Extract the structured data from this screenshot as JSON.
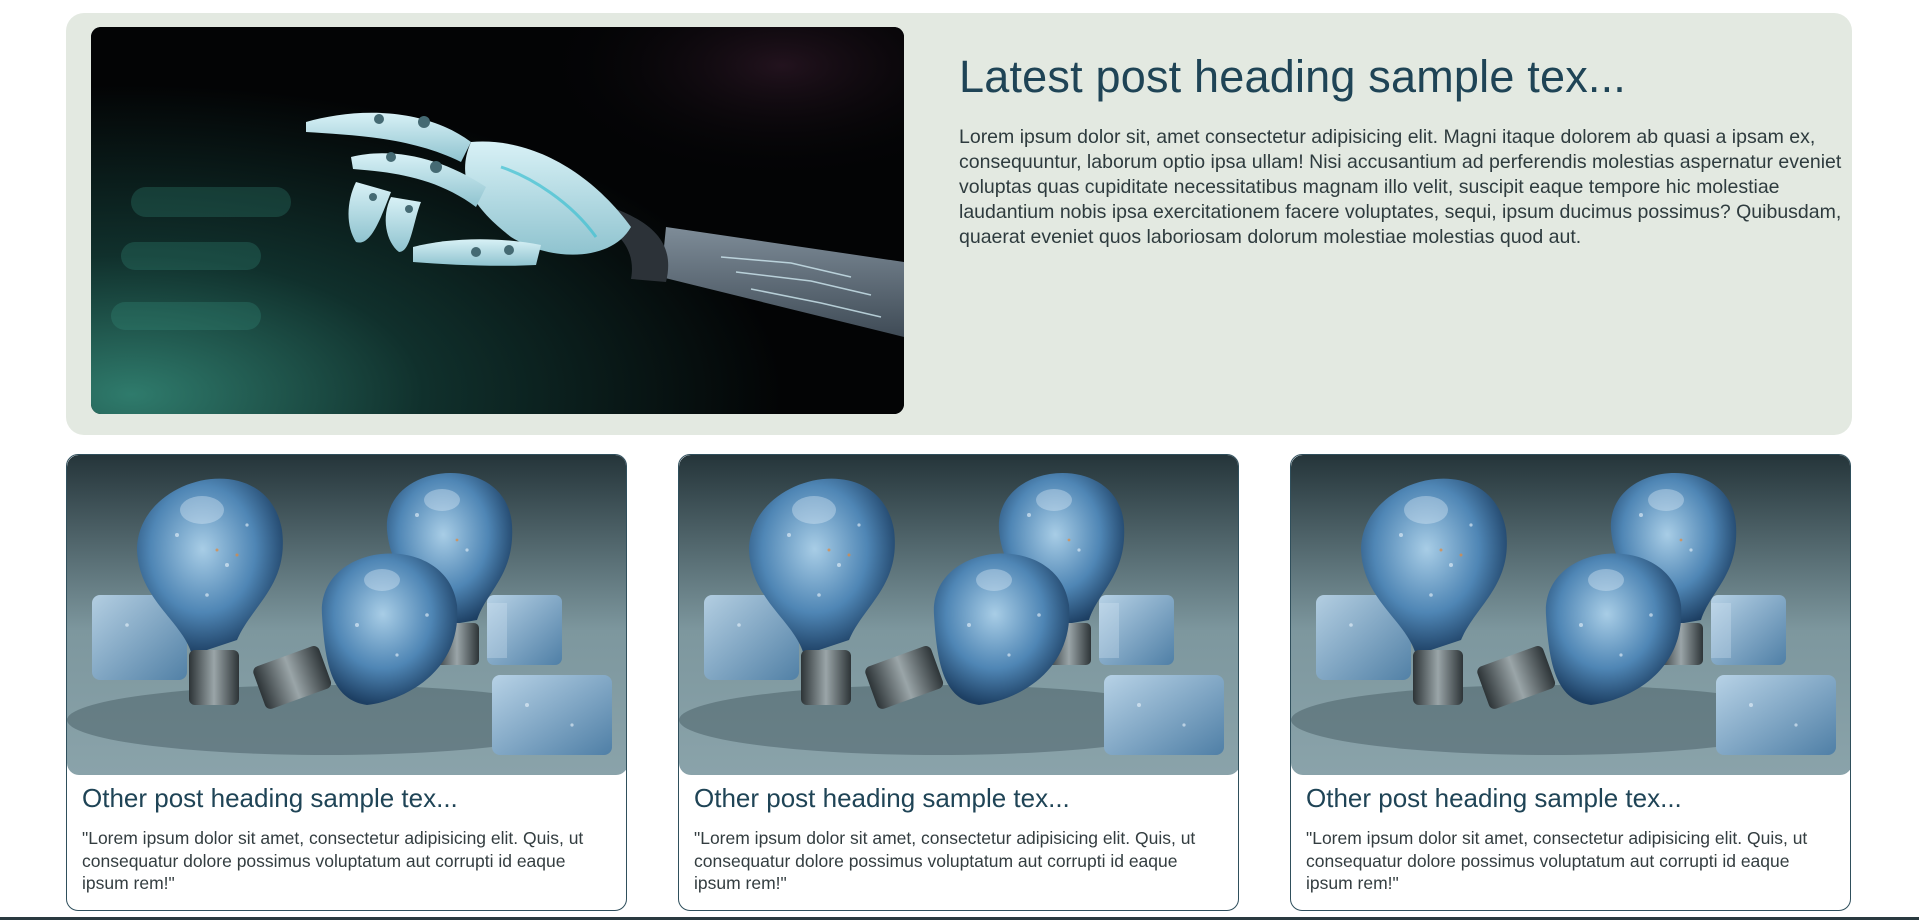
{
  "featured": {
    "image_alt": "Robotic hand reaching forward",
    "title": "Latest post heading sample tex...",
    "body": "Lorem ipsum dolor sit, amet consectetur adipisicing elit. Magni itaque dolorem ab quasi a ipsam ex, consequuntur, laborum optio ipsa ullam! Nisi accusantium ad perferendis molestias aspernatur eveniet voluptas quas cupiditate necessitatibus magnam illo velit, suscipit eaque tempore hic molestiae laudantium nobis ipsa exercitationem facere voluptates, sequi, ipsum ducimus possimus? Quibusdam, quaerat eveniet quos laboriosam dolorum molestiae molestias quod aut."
  },
  "posts": [
    {
      "image_alt": "Frozen light bulbs with ice cubes",
      "title": "Other post heading sample tex...",
      "body": "\"Lorem ipsum dolor sit amet, consectetur adipisicing elit. Quis, ut consequatur dolore possimus voluptatum aut corrupti id eaque ipsum rem!\""
    },
    {
      "image_alt": "Frozen light bulbs with ice cubes",
      "title": "Other post heading sample tex...",
      "body": "\"Lorem ipsum dolor sit amet, consectetur adipisicing elit. Quis, ut consequatur dolore possimus voluptatum aut corrupti id eaque ipsum rem!\""
    },
    {
      "image_alt": "Frozen light bulbs with ice cubes",
      "title": "Other post heading sample tex...",
      "body": "\"Lorem ipsum dolor sit amet, consectetur adipisicing elit. Quis, ut consequatur dolore possimus voluptatum aut corrupti id eaque ipsum rem!\""
    }
  ],
  "colors": {
    "featured_background": "#e3e9e1",
    "heading": "#1f4456",
    "card_border": "#2f4f5c"
  }
}
